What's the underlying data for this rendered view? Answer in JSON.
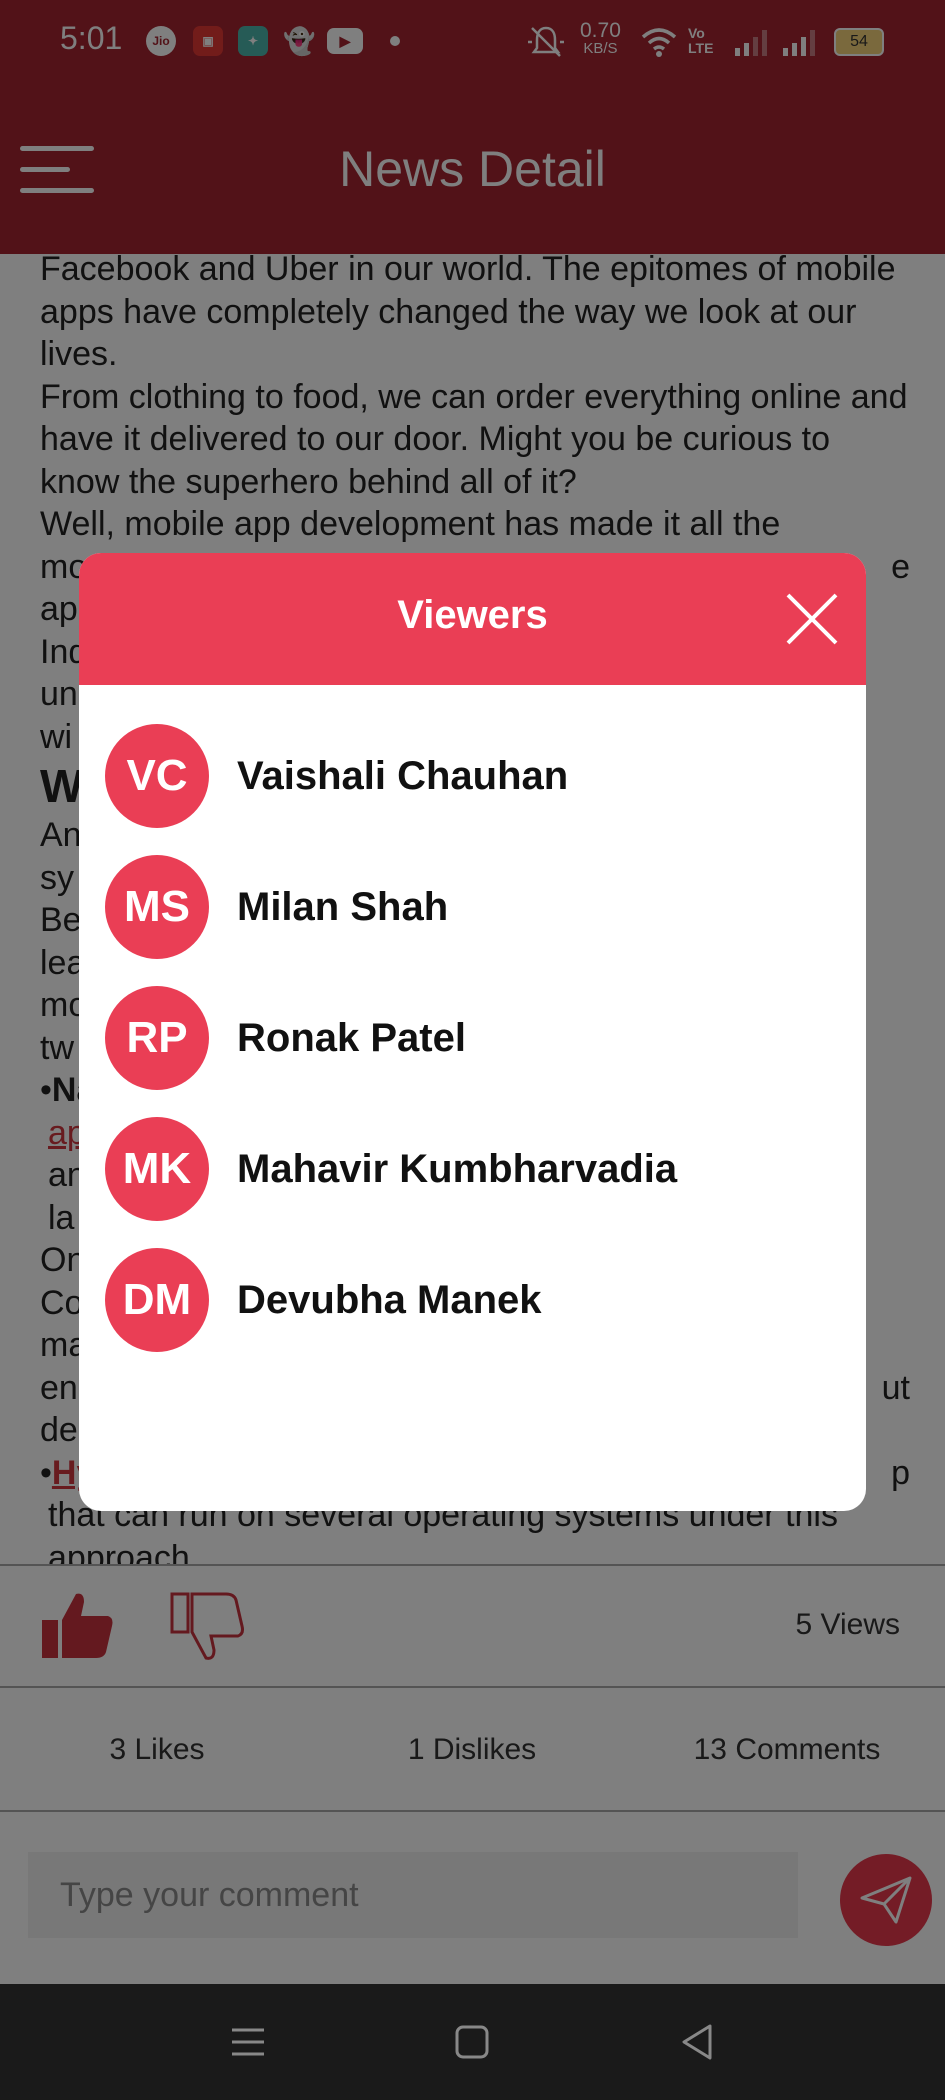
{
  "status_bar": {
    "time": "5:01",
    "icons": [
      "jio-icon",
      "shop-icon",
      "app-icon",
      "snapchat-icon",
      "youtube-icon",
      "dot-icon"
    ],
    "jio_label": "Jio",
    "speed_value": "0.70",
    "speed_unit": "KB/S",
    "battery": "54"
  },
  "header": {
    "title": "News Detail"
  },
  "article": {
    "paragraphs": [
      "Facebook and Uber in our world. The epitomes of mobile apps have completely changed the way we look at our lives.",
      "From clothing to food, we can order everything online and have it delivered to our door. Might you be curious to know the superhero behind all of it?",
      "Well, mobile app development has made it all the",
      "mo",
      "ap",
      "Ind",
      "un",
      "wi"
    ],
    "line_suffix": "e",
    "heading": "W",
    "lines_after": [
      "An",
      "sy",
      "Be",
      "lea",
      "mo",
      "tw"
    ],
    "bullet1_bold": "Na",
    "bullet1_lines": [
      "ap",
      "an",
      "la"
    ],
    "lines_more": [
      "On",
      "Co",
      "ma",
      "en",
      "de"
    ],
    "line_suffix2": "ut",
    "bullet2_link": "Hy",
    "bullet2_suffix": "p",
    "bullet2_line": "that can run on several operating systems under this",
    "bullet2_cut": "approach"
  },
  "actions": {
    "views_label": "5 Views",
    "likes_label": "3 Likes",
    "dislikes_label": "1 Dislikes",
    "comments_label": "13 Comments",
    "comment_placeholder": "Type your comment"
  },
  "modal": {
    "title": "Viewers",
    "viewers": [
      {
        "initials": "VC",
        "name": "Vaishali Chauhan"
      },
      {
        "initials": "MS",
        "name": "Milan Shah"
      },
      {
        "initials": "RP",
        "name": "Ronak Patel"
      },
      {
        "initials": "MK",
        "name": "Mahavir Kumbharvadia"
      },
      {
        "initials": "DM",
        "name": "Devubha Manek"
      }
    ]
  },
  "colors": {
    "header": "#a52530",
    "accent": "#ea3e55",
    "like": "#c8323e"
  }
}
